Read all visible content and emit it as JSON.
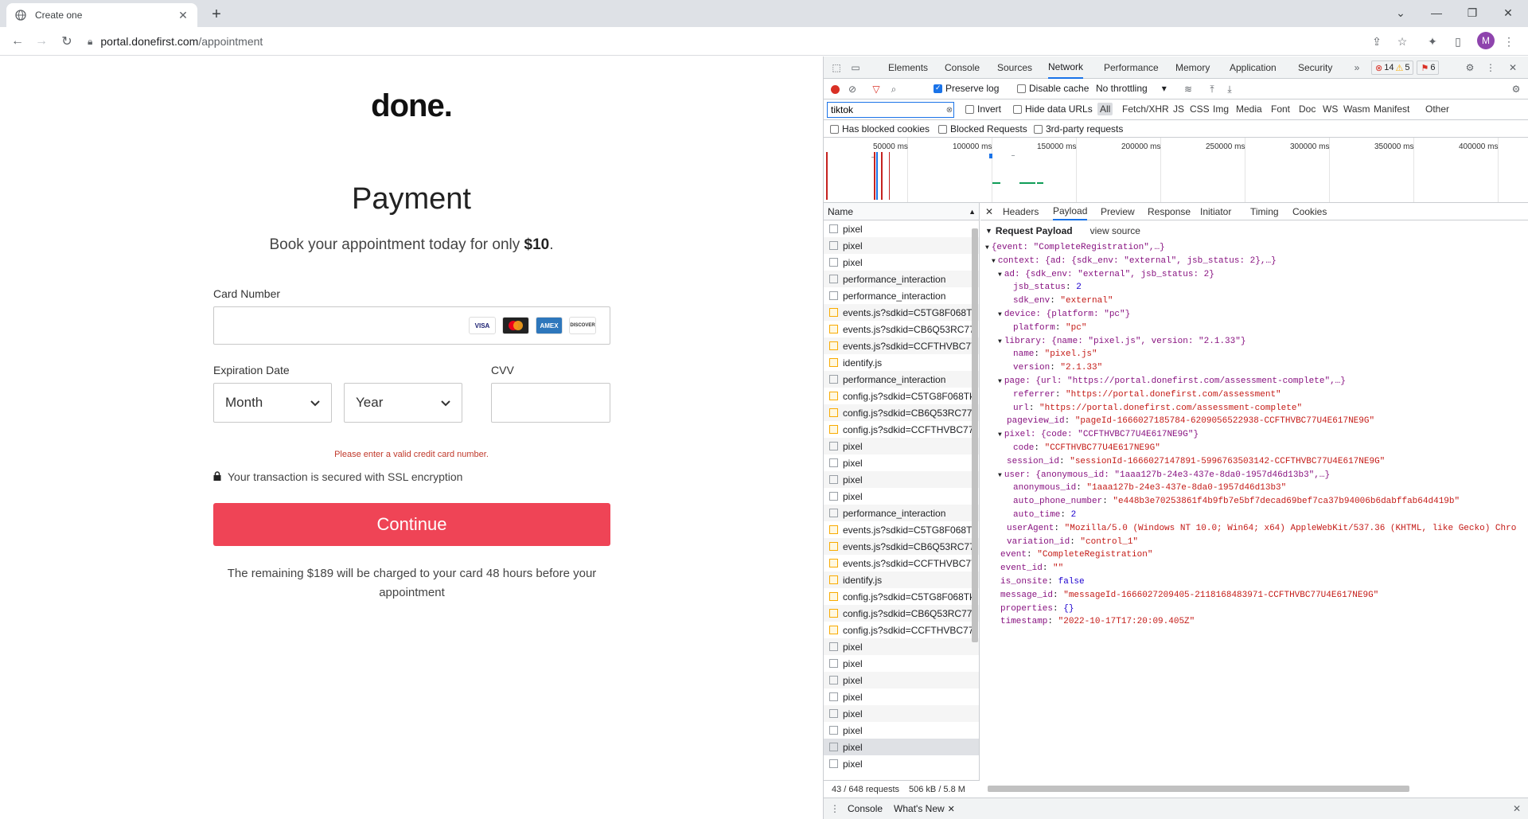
{
  "browser": {
    "tab_title": "Create one",
    "url_host": "portal.donefirst.com",
    "url_path": "/appointment",
    "profile_initial": "M"
  },
  "page": {
    "logo": "done.",
    "title": "Payment",
    "subtitle_prefix": "Book your appointment today for only ",
    "subtitle_price": "$10",
    "subtitle_suffix": ".",
    "card_number_label": "Card Number",
    "card_logos": [
      "VISA",
      "MC",
      "AMEX",
      "DISCOVER"
    ],
    "expiration_label": "Expiration Date",
    "month_value": "Month",
    "year_value": "Year",
    "cvv_label": "CVV",
    "error": "Please enter a valid credit card number.",
    "ssl_note": "Your transaction is secured with SSL encryption",
    "continue_label": "Continue",
    "remaining_note": "The remaining $189 will be charged to your card 48 hours before your appointment"
  },
  "devtools": {
    "tabs": [
      "Elements",
      "Console",
      "Sources",
      "Network",
      "Performance",
      "Memory",
      "Application",
      "Security"
    ],
    "active_tab": "Network",
    "errors": "14",
    "warnings": "5",
    "issues": "6",
    "preserve_log": "Preserve log",
    "disable_cache": "Disable cache",
    "throttling": "No throttling",
    "filter_value": "tiktok",
    "invert": "Invert",
    "hide_data_urls": "Hide data URLs",
    "types": [
      "All",
      "Fetch/XHR",
      "JS",
      "CSS",
      "Img",
      "Media",
      "Font",
      "Doc",
      "WS",
      "Wasm",
      "Manifest",
      "Other"
    ],
    "has_blocked_cookies": "Has blocked cookies",
    "blocked_requests": "Blocked Requests",
    "third_party": "3rd-party requests",
    "timeline_ticks": [
      "50000 ms",
      "100000 ms",
      "150000 ms",
      "200000 ms",
      "250000 ms",
      "300000 ms",
      "350000 ms",
      "400000 ms"
    ],
    "name_header": "Name",
    "requests": [
      {
        "name": "pixel",
        "js": false
      },
      {
        "name": "pixel",
        "js": false
      },
      {
        "name": "pixel",
        "js": false
      },
      {
        "name": "performance_interaction",
        "js": false
      },
      {
        "name": "performance_interaction",
        "js": false
      },
      {
        "name": "events.js?sdkid=C5TG8F068T",
        "js": true
      },
      {
        "name": "events.js?sdkid=CB6Q53RC77",
        "js": true
      },
      {
        "name": "events.js?sdkid=CCFTHVBC77",
        "js": true
      },
      {
        "name": "identify.js",
        "js": true
      },
      {
        "name": "performance_interaction",
        "js": false
      },
      {
        "name": "config.js?sdkid=C5TG8F068Tk",
        "js": true
      },
      {
        "name": "config.js?sdkid=CB6Q53RC77",
        "js": true
      },
      {
        "name": "config.js?sdkid=CCFTHVBC77",
        "js": true
      },
      {
        "name": "pixel",
        "js": false
      },
      {
        "name": "pixel",
        "js": false
      },
      {
        "name": "pixel",
        "js": false
      },
      {
        "name": "pixel",
        "js": false
      },
      {
        "name": "performance_interaction",
        "js": false
      },
      {
        "name": "events.js?sdkid=C5TG8F068T",
        "js": true
      },
      {
        "name": "events.js?sdkid=CB6Q53RC77",
        "js": true
      },
      {
        "name": "events.js?sdkid=CCFTHVBC77",
        "js": true
      },
      {
        "name": "identify.js",
        "js": true
      },
      {
        "name": "config.js?sdkid=C5TG8F068Tk",
        "js": true
      },
      {
        "name": "config.js?sdkid=CB6Q53RC77",
        "js": true
      },
      {
        "name": "config.js?sdkid=CCFTHVBC77",
        "js": true
      },
      {
        "name": "pixel",
        "js": false
      },
      {
        "name": "pixel",
        "js": false
      },
      {
        "name": "pixel",
        "js": false
      },
      {
        "name": "pixel",
        "js": false
      },
      {
        "name": "pixel",
        "js": false
      },
      {
        "name": "pixel",
        "js": false
      },
      {
        "name": "pixel",
        "js": false
      },
      {
        "name": "pixel",
        "js": false
      }
    ],
    "selected_request_index": 31,
    "detail_tabs": [
      "Headers",
      "Payload",
      "Preview",
      "Response",
      "Initiator",
      "Timing",
      "Cookies"
    ],
    "active_detail_tab": "Payload",
    "payload_title": "Request Payload",
    "view_source": "view source",
    "payload_lines": [
      {
        "indent": 1,
        "arrow": "▼",
        "text": "{event: \"CompleteRegistration\",…}"
      },
      {
        "indent": 2,
        "arrow": "▼",
        "text": "context: {ad: {sdk_env: \"external\", jsb_status: 2},…}"
      },
      {
        "indent": 3,
        "arrow": "▼",
        "text": "ad: {sdk_env: \"external\", jsb_status: 2}"
      },
      {
        "indent": 4,
        "key": "jsb_status",
        "val": "2",
        "num": true
      },
      {
        "indent": 4,
        "key": "sdk_env",
        "val": "\"external\""
      },
      {
        "indent": 3,
        "arrow": "▼",
        "text": "device: {platform: \"pc\"}"
      },
      {
        "indent": 4,
        "key": "platform",
        "val": "\"pc\""
      },
      {
        "indent": 3,
        "arrow": "▼",
        "text": "library: {name: \"pixel.js\", version: \"2.1.33\"}"
      },
      {
        "indent": 4,
        "key": "name",
        "val": "\"pixel.js\""
      },
      {
        "indent": 4,
        "key": "version",
        "val": "\"2.1.33\""
      },
      {
        "indent": 3,
        "arrow": "▼",
        "text": "page: {url: \"https://portal.donefirst.com/assessment-complete\",…}"
      },
      {
        "indent": 4,
        "key": "referrer",
        "val": "\"https://portal.donefirst.com/assessment\""
      },
      {
        "indent": 4,
        "key": "url",
        "val": "\"https://portal.donefirst.com/assessment-complete\""
      },
      {
        "indent": 3,
        "key": "pageview_id",
        "val": "\"pageId-1666027185784-6209056522938-CCFTHVBC77U4E617NE9G\""
      },
      {
        "indent": 3,
        "arrow": "▼",
        "text": "pixel: {code: \"CCFTHVBC77U4E617NE9G\"}"
      },
      {
        "indent": 4,
        "key": "code",
        "val": "\"CCFTHVBC77U4E617NE9G\""
      },
      {
        "indent": 3,
        "key": "session_id",
        "val": "\"sessionId-1666027147891-5996763503142-CCFTHVBC77U4E617NE9G\""
      },
      {
        "indent": 3,
        "arrow": "▼",
        "text": "user: {anonymous_id: \"1aaa127b-24e3-437e-8da0-1957d46d13b3\",…}"
      },
      {
        "indent": 4,
        "key": "anonymous_id",
        "val": "\"1aaa127b-24e3-437e-8da0-1957d46d13b3\""
      },
      {
        "indent": 4,
        "key": "auto_phone_number",
        "val": "\"e448b3e70253861f4b9fb7e5bf7decad69bef7ca37b94006b6dabffab64d419b\""
      },
      {
        "indent": 4,
        "key": "auto_time",
        "val": "2",
        "num": true
      },
      {
        "indent": 3,
        "key": "userAgent",
        "val": "\"Mozilla/5.0 (Windows NT 10.0; Win64; x64) AppleWebKit/537.36 (KHTML, like Gecko) Chro"
      },
      {
        "indent": 3,
        "key": "variation_id",
        "val": "\"control_1\""
      },
      {
        "indent": 2,
        "key": "event",
        "val": "\"CompleteRegistration\""
      },
      {
        "indent": 2,
        "key": "event_id",
        "val": "\"\""
      },
      {
        "indent": 2,
        "key": "is_onsite",
        "val": "false",
        "num": true
      },
      {
        "indent": 2,
        "key": "message_id",
        "val": "\"messageId-1666027209405-2118168483971-CCFTHVBC77U4E617NE9G\""
      },
      {
        "indent": 2,
        "key": "properties",
        "val": "{}",
        "num": true
      },
      {
        "indent": 2,
        "key": "timestamp",
        "val": "\"2022-10-17T17:20:09.405Z\""
      }
    ],
    "status_requests": "43 / 648 requests",
    "status_size": "506 kB / 5.8 M",
    "drawer_console": "Console",
    "drawer_whats_new": "What's New"
  }
}
